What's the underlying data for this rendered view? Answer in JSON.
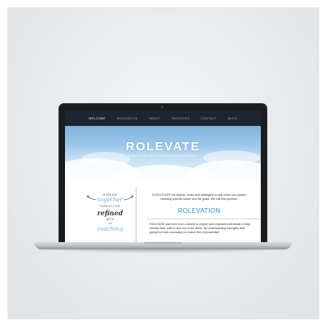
{
  "navigation": {
    "items": [
      {
        "label": "WELCOME",
        "active": true
      },
      {
        "label": "ROLEVATION",
        "active": false
      },
      {
        "label": "ABOUT",
        "active": false
      },
      {
        "label": "PACKAGES",
        "active": false
      },
      {
        "label": "CONTACT",
        "active": false
      },
      {
        "label": "BLOG",
        "active": false
      }
    ]
  },
  "hero": {
    "title": "ROLEVATE",
    "subtitle": "A CAREER EMPOWERMENT COMPANY"
  },
  "quote": {
    "lines": [
      "WHERE",
      "together",
      "THROUGH",
      "refined",
      "MIX",
      "OF",
      "coaching"
    ]
  },
  "intro": {
    "text": "At ROLEVATE we assess, foster and strategize to help move you toward reaching specific career and life goals. We call this process:",
    "highlight": "ROLEVATION"
  },
  "about": {
    "text": "ROLEVATE was born from a desire to inspire and empower individuals to help elevate their roles in and out of the office, by understanding strengths and giving the tools necessary to realize their full potential!"
  },
  "colors": {
    "nav_background": "#1f2530",
    "accent": "#2f8fd8",
    "script_accent": "#6fb1de"
  }
}
